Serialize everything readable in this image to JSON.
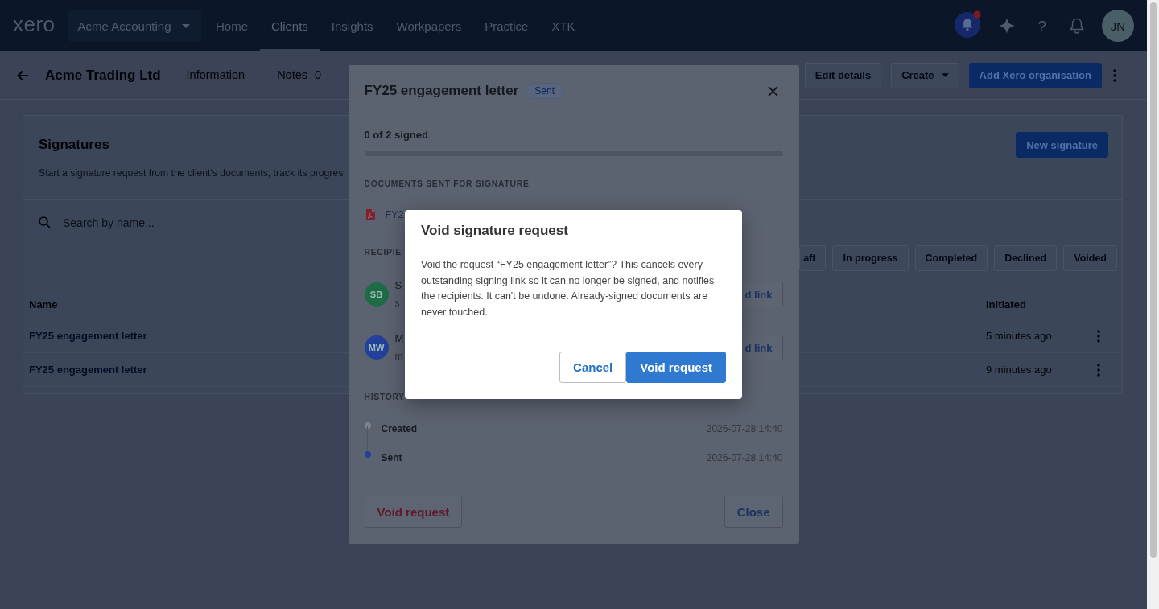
{
  "top_nav": {
    "logo": "xero",
    "organisation": "Acme Accounting",
    "items": [
      {
        "label": "Home",
        "selected": false
      },
      {
        "label": "Clients",
        "selected": true
      },
      {
        "label": "Insights",
        "selected": false
      },
      {
        "label": "Workpapers",
        "selected": false
      },
      {
        "label": "Practice",
        "selected": false
      },
      {
        "label": "XTK",
        "selected": false
      }
    ],
    "help": "?",
    "avatar": "JN"
  },
  "client_header": {
    "title": "Acme Trading Ltd",
    "tabs": [
      {
        "label": "Information",
        "selected": false
      },
      {
        "label": "Notes",
        "count": "0",
        "selected": false
      }
    ],
    "actions": [
      {
        "label": "Edit details",
        "kind": "outline"
      },
      {
        "label": "Create",
        "kind": "dropdown"
      },
      {
        "label": "Add Xero organisation",
        "kind": "primary"
      }
    ]
  },
  "signatures": {
    "title": "Signatures",
    "subtitle": "Start a signature request from the client's documents, track its progres",
    "new_button": "New signature",
    "search": {
      "placeholder": "Search by name..."
    },
    "filters": [
      {
        "label": "aft",
        "selected": false
      },
      {
        "label": "In progress",
        "selected": false
      },
      {
        "label": "Completed",
        "selected": false
      },
      {
        "label": "Declined",
        "selected": false
      },
      {
        "label": "Voided",
        "selected": false
      }
    ],
    "table": {
      "columns": [
        "Name",
        "Initiated"
      ],
      "rows": [
        {
          "name": "FY25 engagement letter",
          "initiated": "5 minutes ago"
        },
        {
          "name": "FY25 engagement letter",
          "initiated": "9 minutes ago"
        }
      ]
    }
  },
  "request_modal": {
    "title": "FY25 engagement letter",
    "status": "Sent",
    "progress": {
      "label": "0 of 2 signed",
      "level": 0
    },
    "documents_heading": "DOCUMENTS SENT FOR SIGNATURE",
    "documents": [
      {
        "name": "FY2"
      }
    ],
    "recipients_heading": "RECIPIE",
    "recipients": [
      {
        "initials": "SB",
        "color": "#1f6b45",
        "name": "S",
        "email": "s",
        "action": "d link"
      },
      {
        "initials": "MW",
        "color": "#23409a",
        "name": "M",
        "email": "m",
        "action": "d link"
      }
    ],
    "history_heading": "HISTORY",
    "history": [
      {
        "event": "Created",
        "time": "2026-07-28 14:40",
        "color": "#7c828c"
      },
      {
        "event": "Sent",
        "time": "2026-07-28 14:40",
        "color": "#23409a"
      }
    ],
    "buttons": [
      {
        "label": "Void request",
        "kind": "danger"
      },
      {
        "label": "Close",
        "kind": "secondary"
      }
    ]
  },
  "confirm_dialog": {
    "title": "Void signature request",
    "message": "Void the request “FY25 engagement letter”? This cancels every outstanding signing link so it can no longer be signed, and notifies the recipients. It can't be undone. Already-signed documents are never touched.",
    "buttons": [
      {
        "label": "Cancel",
        "kind": "secondary"
      },
      {
        "label": "Void request",
        "kind": "primary"
      }
    ]
  }
}
